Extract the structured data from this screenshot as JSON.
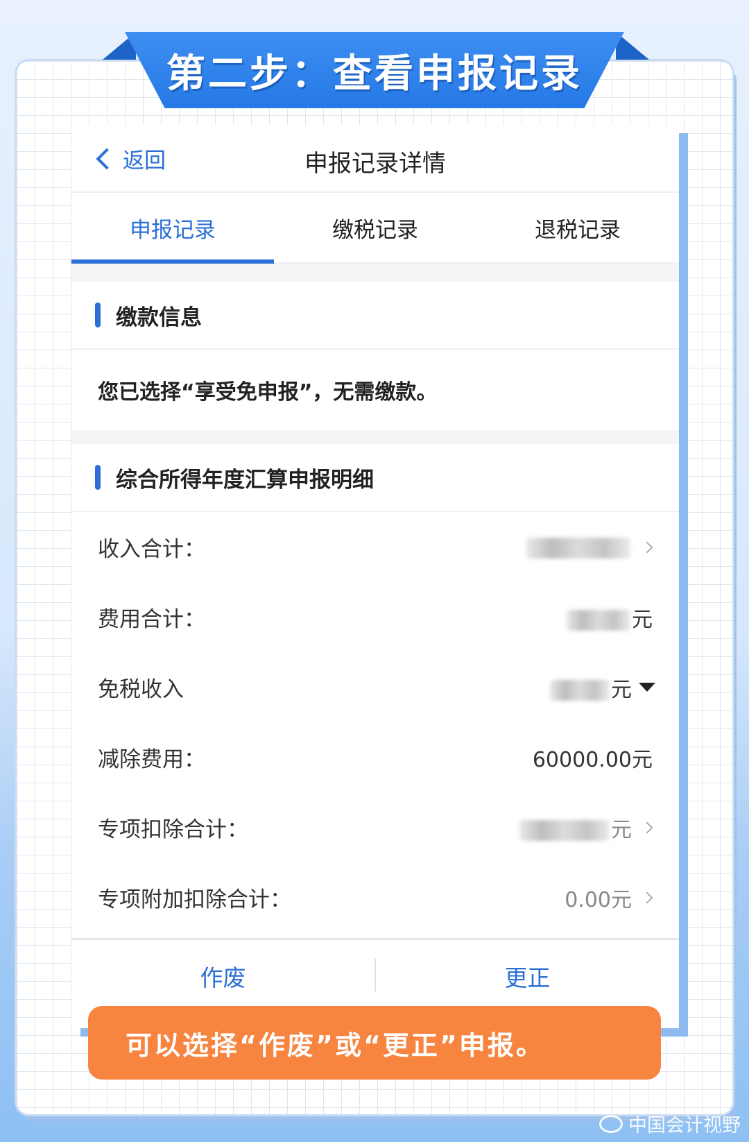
{
  "banner": {
    "title": "第二步：查看申报记录"
  },
  "nav": {
    "back_label": "返回",
    "title": "申报记录详情"
  },
  "tabs": [
    {
      "label": "申报记录",
      "active": true
    },
    {
      "label": "缴税记录",
      "active": false
    },
    {
      "label": "退税记录",
      "active": false
    }
  ],
  "payment": {
    "heading": "缴款信息",
    "message": "您已选择“享受免申报”，无需缴款。"
  },
  "details": {
    "heading": "综合所得年度汇算申报明细",
    "rows": [
      {
        "label": "收入合计：",
        "value": "",
        "suffix": "",
        "redacted": true,
        "control": "chevron-right-icon"
      },
      {
        "label": "费用合计：",
        "value": "",
        "suffix": "元",
        "redacted": true,
        "control": ""
      },
      {
        "label": "免税收入",
        "value": "",
        "suffix": "元",
        "redacted": true,
        "control": "caret-down-icon"
      },
      {
        "label": "减除费用：",
        "value": "60000.00元",
        "suffix": "",
        "redacted": false,
        "control": ""
      },
      {
        "label": "专项扣除合计：",
        "value": "",
        "suffix": "元",
        "redacted": true,
        "control": "chevron-right-icon"
      },
      {
        "label": "专项附加扣除合计：",
        "value": "0.00元",
        "suffix": "",
        "redacted": false,
        "control": "chevron-right-icon"
      }
    ]
  },
  "footer": {
    "void_label": "作废",
    "correct_label": "更正"
  },
  "callout": {
    "text": "可以选择“作废”或“更正”申报。"
  },
  "watermark": {
    "text": "中国会计视野"
  },
  "colors": {
    "accent": "#2b6fd6",
    "banner": "#2679e6",
    "callout": "#f7843f"
  }
}
